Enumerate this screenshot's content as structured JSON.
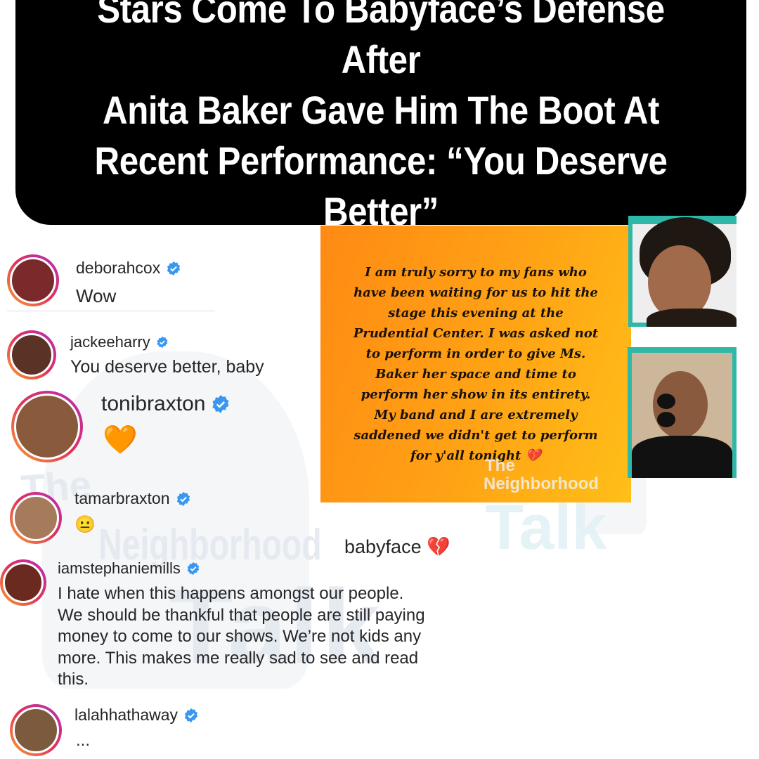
{
  "headline": {
    "line1": "Stars Come To Babyface’s Defense After",
    "line2": "Anita Baker Gave Him The Boot At",
    "line3": "Recent Performance: “You Deserve",
    "line4": "Better”"
  },
  "statement": {
    "line1": "I am truly sorry to my fans who",
    "line2": "have been waiting for us to hit the",
    "line3": "stage this evening at the",
    "line4": "Prudential Center. I was asked not",
    "line5": "to perform in order to give Ms.",
    "line6": "Baker her space and time to",
    "line7": "perform her show in its entirety.",
    "line8": "My band and I are extremely",
    "line9": "saddened we didn't get to perform",
    "line10": "for y'all tonight 💔"
  },
  "watermark": {
    "line1": "The",
    "line2": "Neighborhood",
    "line3": "Talk"
  },
  "babyface_label": "babyface 💔",
  "comments": [
    {
      "user": "deborahcox",
      "text": "Wow"
    },
    {
      "user": "jackeeharry",
      "text": "You deserve better, baby"
    },
    {
      "user": "tonibraxton",
      "text": "🧡"
    },
    {
      "user": "tamarbraxton",
      "text": "😐"
    },
    {
      "user": "iamstephaniemills",
      "text_lines": [
        "I hate when this happens amongst our people.",
        "We should be thankful that people are still paying",
        "money to come to our shows.  We’re not kids any",
        "more.  This makes me really sad to see and read",
        "this."
      ]
    },
    {
      "user": "lalahhathaway",
      "text": "..."
    }
  ],
  "colors": {
    "verified_blue": "#3897f0",
    "card_orange": "#ffa315",
    "frame_teal": "#2fb8a8",
    "headline_bg": "#000000"
  },
  "icons": {
    "verified": "verified-badge-icon"
  }
}
